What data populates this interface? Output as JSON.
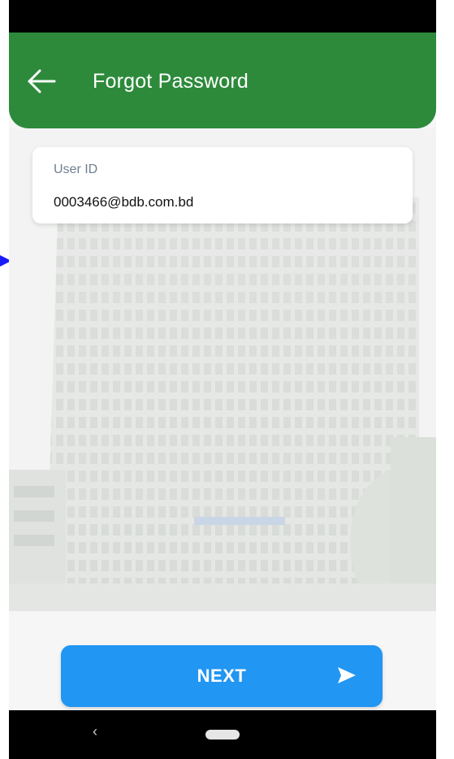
{
  "app_bar": {
    "title": "Forgot Password",
    "back_icon": "arrow-left-icon",
    "color": "#2d8a3b"
  },
  "form": {
    "user_id_label": "User ID",
    "user_id_value": "0003466@bdb.com.bd"
  },
  "actions": {
    "next_label": "NEXT",
    "next_icon": "send-arrow-icon",
    "color": "#2196f3"
  },
  "nav_bar": {
    "back_glyph": "‹",
    "home_icon": "home-pill-icon"
  }
}
